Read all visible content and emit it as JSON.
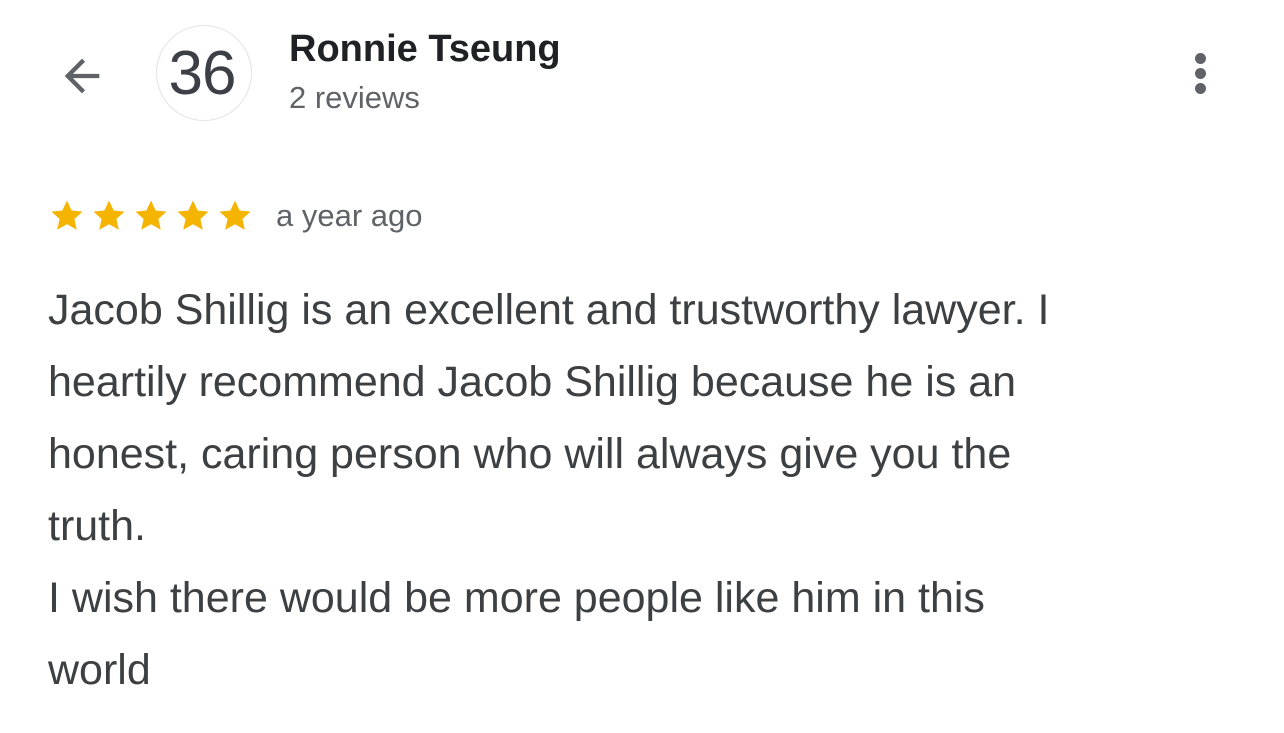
{
  "header": {
    "back_icon": "arrow-back-icon",
    "avatar_text": "36",
    "name": "Ronnie Tseung",
    "review_count": "2 reviews",
    "more_icon": "more-vert-icon"
  },
  "review": {
    "rating": 5,
    "rating_max": 5,
    "star_color": "#F4B400",
    "date": "a year ago",
    "lines": [
      "Jacob Shillig is an excellent and trustworthy lawyer. I",
      "heartily recommend Jacob Shillig because he is an",
      "honest, caring person who will always give you the",
      "truth.",
      "I wish there would be more people like him in this",
      "world"
    ]
  }
}
